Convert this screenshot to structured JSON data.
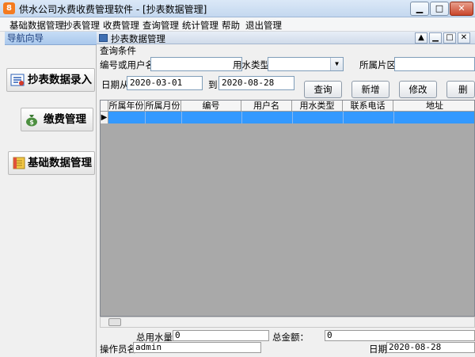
{
  "window": {
    "title": "供水公司水费收费管理软件 - [抄表数据管理]",
    "icon_char": "8",
    "minimize": "▁",
    "restore": "□",
    "close": "✕"
  },
  "menu": [
    "基础数据管理",
    "抄表管理",
    "收费管理",
    "查询管理",
    "统计管理",
    "帮助",
    "退出管理"
  ],
  "nav": {
    "header": "导航向导",
    "buttons": [
      {
        "label": "抄表数据录入",
        "icon": "meter-entry-icon"
      },
      {
        "label": "缴费管理",
        "icon": "money-bag-icon"
      },
      {
        "label": "基础数据管理",
        "icon": "database-icon"
      }
    ]
  },
  "child": {
    "title": "抄表数据管理",
    "group_label": "查询条件",
    "labels": {
      "code_or_name": "编号或用户名",
      "water_type": "用水类型",
      "area": "所属片区",
      "date_from": "日期从",
      "date_to": "到"
    },
    "inputs": {
      "code_or_name": "",
      "water_type": "",
      "area": "",
      "date_from": "2020-03-01",
      "date_to": "2020-08-28"
    },
    "buttons": {
      "query": "查询",
      "add": "新增",
      "edit": "修改",
      "delete": "删除"
    },
    "grid": {
      "columns": [
        "所属年份",
        "所属月份",
        "编号",
        "用户名",
        "用水类型",
        "联系电话",
        "地址"
      ],
      "row_marker": "▶"
    },
    "status": {
      "total_water_label": "总用水量：",
      "total_water_value": "0",
      "total_amount_label": "总金额：",
      "total_amount_value": "0",
      "operator_label": "操作员名",
      "operator_value": "admin",
      "date_label": "日期",
      "date_value": "2020-08-28"
    }
  },
  "colors": {
    "selection": "#3399ff",
    "accent": "#f47b20"
  }
}
